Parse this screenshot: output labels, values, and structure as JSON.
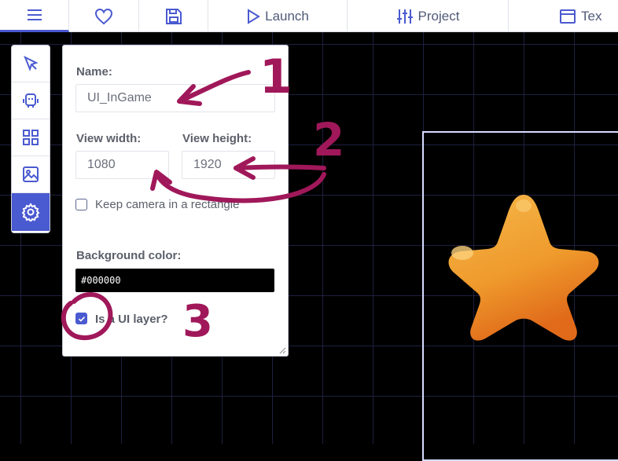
{
  "toolbar": {
    "menu_icon": "hamburger-menu-icon",
    "favorite_icon": "heart-icon",
    "save_icon": "floppy-disk-icon",
    "launch_label": "Launch",
    "project_label": "Project",
    "texture_label": "Tex"
  },
  "side_tools": [
    "cursor-arrow-icon",
    "robot-icon",
    "grid-icon",
    "image-icon",
    "gear-icon"
  ],
  "panel": {
    "name_label": "Name:",
    "name_value": "UI_InGame",
    "view_width_label": "View width:",
    "view_width_value": "1080",
    "view_height_label": "View height:",
    "view_height_value": "1920",
    "keep_camera_label": "Keep camera in a rectangle",
    "keep_camera_checked": false,
    "background_color_label": "Background color:",
    "background_color_value": "#000000",
    "ui_layer_label": "Is a UI layer?",
    "ui_layer_checked": true
  },
  "annotations": {
    "number_1": "1",
    "number_2": "2",
    "number_3": "3",
    "color": "#a0185a"
  },
  "colors": {
    "accent": "#4a5ad0",
    "canvas": "#000000",
    "star": "#f0a030"
  }
}
